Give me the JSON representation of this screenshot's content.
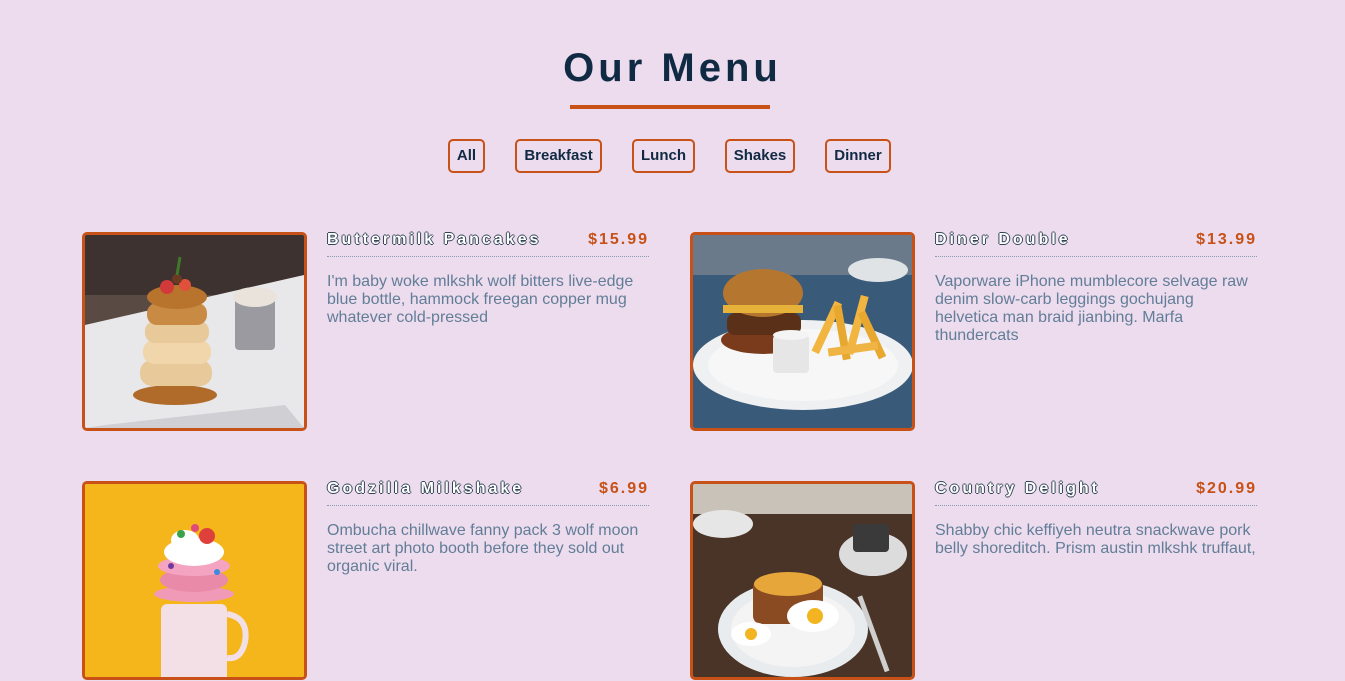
{
  "header": {
    "title": "Our Menu"
  },
  "filters": [
    "All",
    "Breakfast",
    "Lunch",
    "Shakes",
    "Dinner"
  ],
  "menu_items": [
    {
      "name": "Buttermilk Pancakes",
      "price": "$15.99",
      "description": "I'm baby woke mlkshk wolf bitters live-edge blue bottle, hammock freegan copper mug whatever cold-pressed",
      "image": "pancakes-photo"
    },
    {
      "name": "Diner Double",
      "price": "$13.99",
      "description": "Vaporware iPhone mumblecore selvage raw denim slow-carb leggings gochujang helvetica man braid jianbing. Marfa thundercats",
      "image": "burger-photo"
    },
    {
      "name": "Godzilla Milkshake",
      "price": "$6.99",
      "description": "Ombucha chillwave fanny pack 3 wolf moon street art photo booth before they sold out organic viral.",
      "image": "milkshake-photo"
    },
    {
      "name": "Country Delight",
      "price": "$20.99",
      "description": "Shabby chic keffiyeh neutra snackwave pork belly shoreditch. Prism austin mlkshk truffaut,",
      "image": "breakfast-plate-photo"
    }
  ],
  "colors": {
    "background": "#ecdced",
    "accent": "#c75116",
    "heading": "#102a43",
    "body_text": "#627d98"
  }
}
